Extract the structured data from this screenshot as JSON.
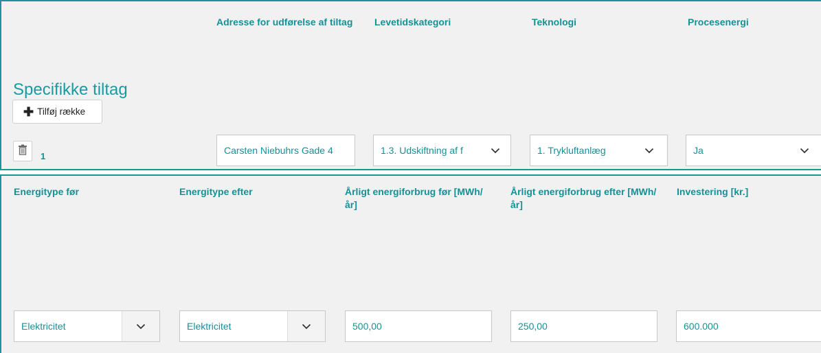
{
  "top": {
    "headers": {
      "address": "Adresse for udførelse af tiltag",
      "lifetime": "Levetidskategori",
      "technology": "Teknologi",
      "process_energy": "Procesenergi"
    },
    "section_title": "Specifikke tiltag",
    "add_row_label": "Tilføj række",
    "row_number": "1",
    "fields": {
      "address": "Carsten Niebuhrs Gade 4",
      "lifetime": "1.3. Udskiftning af f",
      "technology": "1. Trykluftanlæg",
      "process_energy": "Ja"
    }
  },
  "bottom": {
    "headers": {
      "energy_before": "Energitype før",
      "energy_after": "Energitype efter",
      "usage_before": "Årligt energiforbrug før [MWh/år]",
      "usage_after": "Årligt energiforbrug efter [MWh/år]",
      "investment": "Investering [kr.]"
    },
    "fields": {
      "energy_before": "Elektricitet",
      "energy_after": "Elektricitet",
      "usage_before": "500,00",
      "usage_after": "250,00",
      "investment": "600.000"
    }
  },
  "icons": {
    "add": "plus-icon",
    "delete": "trash-icon",
    "dropdown": "chevron-down-icon"
  },
  "colors": {
    "accent": "#149196",
    "border": "#1a9494",
    "panel_bg": "#f1f1f1"
  }
}
